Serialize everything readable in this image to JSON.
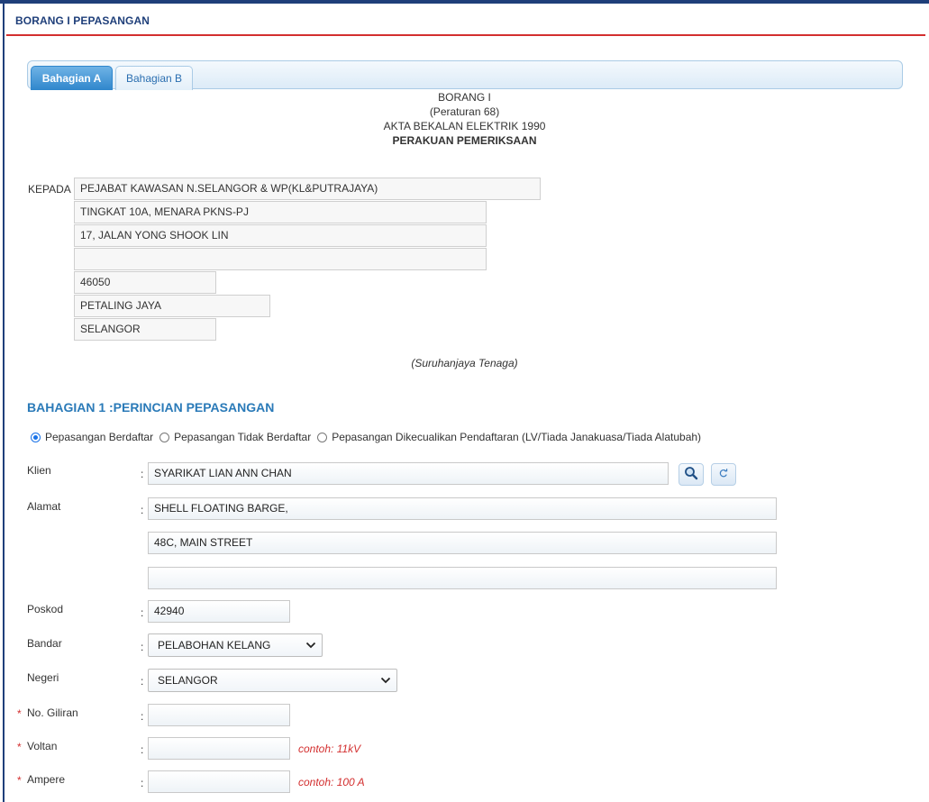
{
  "page": {
    "title": "BORANG I PEPASANGAN"
  },
  "tabs": [
    {
      "label": "Bahagian A",
      "active": true
    },
    {
      "label": "Bahagian B",
      "active": false
    }
  ],
  "form_header": {
    "line1": "BORANG I",
    "line2": "(Peraturan 68)",
    "line3": "AKTA BEKALAN ELEKTRIK 1990",
    "line4": "PERAKUAN PEMERIKSAAN"
  },
  "kepada": {
    "label": "KEPADA",
    "lines": [
      "PEJABAT KAWASAN  N.SELANGOR & WP(KL&PUTRAJAYA)",
      "TINGKAT 10A, MENARA PKNS-PJ",
      "17, JALAN YONG SHOOK LIN",
      "",
      "46050",
      "PETALING JAYA",
      "SELANGOR"
    ],
    "note": "(Suruhanjaya Tenaga)"
  },
  "section1": {
    "heading": "BAHAGIAN 1 :PERINCIAN PEPASANGAN",
    "radios": [
      {
        "label": "Pepasangan Berdaftar",
        "checked": true
      },
      {
        "label": "Pepasangan Tidak Berdaftar",
        "checked": false
      },
      {
        "label": "Pepasangan Dikecualikan Pendaftaran (LV/Tiada Janakuasa/Tiada Alatubah)",
        "checked": false
      }
    ],
    "fields": {
      "klien": {
        "label": "Klien",
        "value": "SYARIKAT LIAN ANN CHAN"
      },
      "alamat": {
        "label": "Alamat",
        "line1": "SHELL FLOATING BARGE,",
        "line2": "48C, MAIN STREET",
        "line3": ""
      },
      "poskod": {
        "label": "Poskod",
        "value": "42940"
      },
      "bandar": {
        "label": "Bandar",
        "selected": "PELABOHAN KELANG"
      },
      "negeri": {
        "label": "Negeri",
        "selected": "SELANGOR"
      },
      "no_giliran": {
        "label": "No. Giliran",
        "value": "",
        "required": true
      },
      "voltan": {
        "label": "Voltan",
        "value": "",
        "required": true,
        "hint": "contoh: 11kV"
      },
      "ampere": {
        "label": "Ampere",
        "value": "",
        "required": true,
        "hint": "contoh: 100 A"
      }
    },
    "colon": ":",
    "required_mark": "*"
  },
  "icons": {
    "search": "magnifier-icon",
    "refresh": "refresh-icon"
  },
  "colors": {
    "accent": "#2a7ab8",
    "title": "#1f3f7a",
    "rule": "#d32f2f",
    "hint": "#d32f2f"
  }
}
